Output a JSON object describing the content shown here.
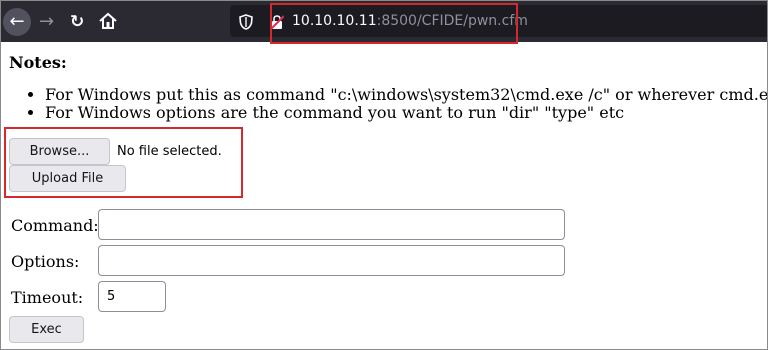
{
  "browser": {
    "url_host": "10.10.10.11",
    "url_rest": ":8500/CFIDE/pwn.cfm"
  },
  "page": {
    "notes_title": "Notes:",
    "notes": [
      "For Windows put this as command \"c:\\windows\\system32\\cmd.exe /c\" or wherever cmd.exe is",
      "For Windows options are the command you want to run \"dir\" \"type\" etc"
    ],
    "browse_label": "Browse...",
    "file_status": "No file selected.",
    "upload_label": "Upload File",
    "command_label": "Command:",
    "command_value": "",
    "options_label": "Options:",
    "options_value": "",
    "timeout_label": "Timeout:",
    "timeout_value": "5",
    "exec_label": "Exec"
  },
  "colors": {
    "toolbar_bg": "#2b2a33",
    "urlbar_bg": "#1c1b22",
    "highlight_red": "#d3292f",
    "button_bg": "#e9e9ed"
  },
  "icons": [
    "back-arrow-icon",
    "forward-arrow-icon",
    "reload-icon",
    "home-icon",
    "shield-icon",
    "lock-icon"
  ]
}
